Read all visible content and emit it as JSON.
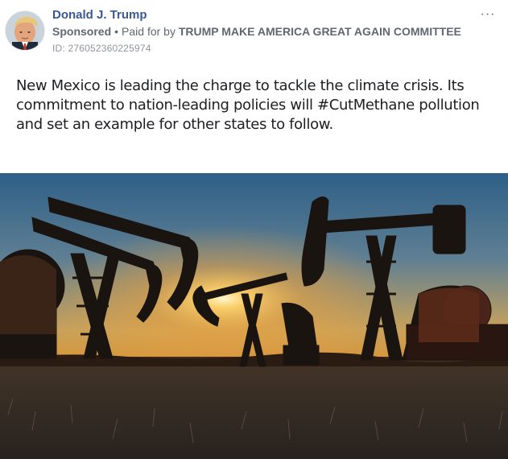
{
  "post": {
    "page_name": "Donald J. Trump",
    "sponsored_label": "Sponsored",
    "paid_for_prefix": "Paid for by",
    "paid_for_by": "TRUMP MAKE AMERICA GREAT AGAIN COMMITTEE",
    "ad_id": "ID: 276052360225974",
    "more_icon": "more-horizontal-icon",
    "more_label": "···",
    "text": "New Mexico is leading the charge to tackle the climate crisis. Its commitment to nation-leading policies will #CutMethane pollution and set an example for other states to follow.",
    "image_description_icon": "oil-pumpjacks-sunset-photo"
  },
  "colors": {
    "link": "#385898",
    "meta": "#606770",
    "id": "#90949c",
    "text": "#1c1e21"
  }
}
